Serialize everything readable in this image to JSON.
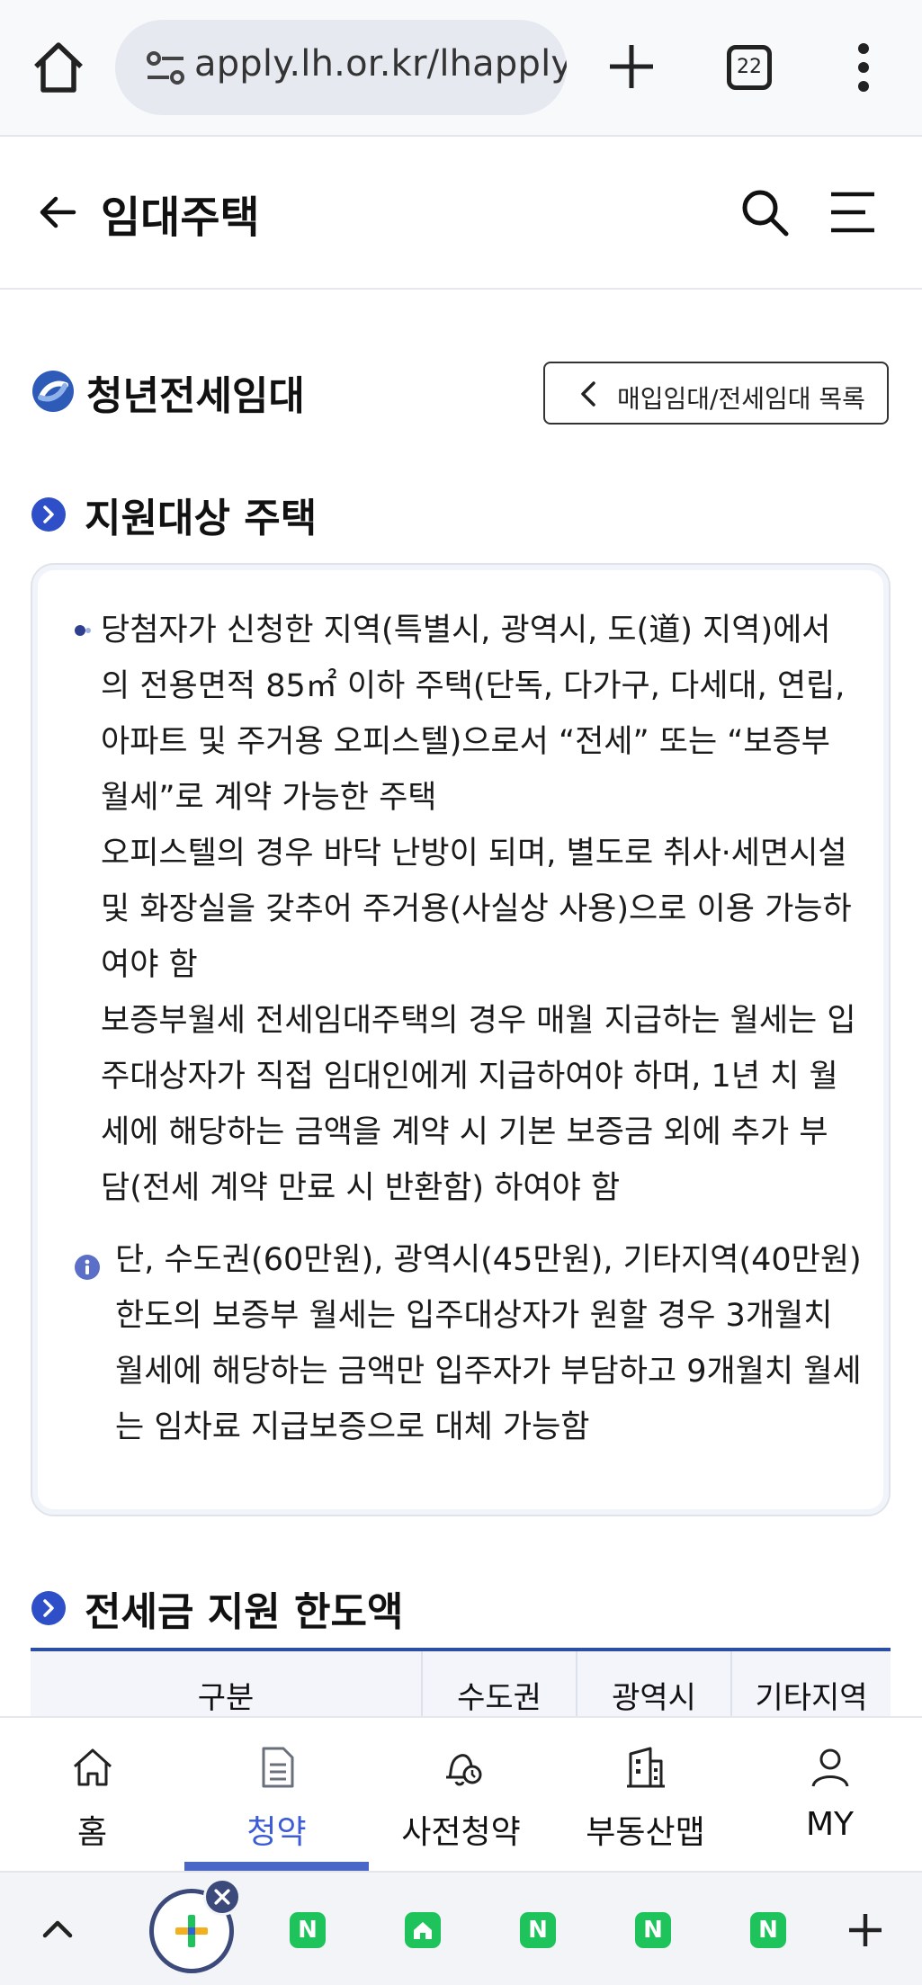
{
  "browser": {
    "url": "apply.lh.or.kr/lhapplyweb",
    "tab_count": "22"
  },
  "header": {
    "title": "임대주택"
  },
  "section": {
    "title": "청년전세임대",
    "list_button": "매입임대/전세임대 목록"
  },
  "support_house": {
    "heading": "지원대상 주택",
    "paragraph_1": "당첨자가 신청한 지역(특별시, 광역시, 도(道) 지역)에서의 전용면적 85㎡ 이하 주택(단독, 다가구, 다세대, 연립, 아파트 및 주거용 오피스텔)으로서 “전세” 또는 “보증부월세”로 계약 가능한 주택",
    "paragraph_2": "오피스텔의 경우 바닥 난방이 되며, 별도로 취사·세면시설 및 화장실을 갖추어 주거용(사실상 사용)으로 이용 가능하여야 함",
    "paragraph_3": "보증부월세 전세임대주택의 경우 매월 지급하는 월세는 입주대상자가 직접 임대인에게 지급하여야 하며, 1년 치 월세에 해당하는 금액을 계약 시 기본 보증금 외에 추가 부담(전세 계약 만료 시 반환함) 하여야 함",
    "note": "단, 수도권(60만원), 광역시(45만원), 기타지역(40만원) 한도의 보증부 월세는 입주대상자가 원할 경우 3개월치 월세에 해당하는 금액만 입주자가 부담하고 9개월치 월세는 임차료 지급보증으로 대체 가능함"
  },
  "limit": {
    "heading": "전세금 지원 한도액",
    "columns": [
      "구분",
      "수도권",
      "광역시",
      "기타지역"
    ]
  },
  "bottom_nav": {
    "items": [
      {
        "label": "홈",
        "icon": "home-icon"
      },
      {
        "label": "청약",
        "icon": "document-icon"
      },
      {
        "label": "사전청약",
        "icon": "bell-clock-icon"
      },
      {
        "label": "부동산맵",
        "icon": "building-icon"
      },
      {
        "label": "MY",
        "icon": "person-icon"
      }
    ],
    "active_index": 1
  },
  "toolbar": {
    "tab_letter": "N"
  },
  "colors": {
    "accent": "#3b5bd9",
    "table_rule": "#2a4fa3",
    "naver_green": "#1fc35b"
  }
}
